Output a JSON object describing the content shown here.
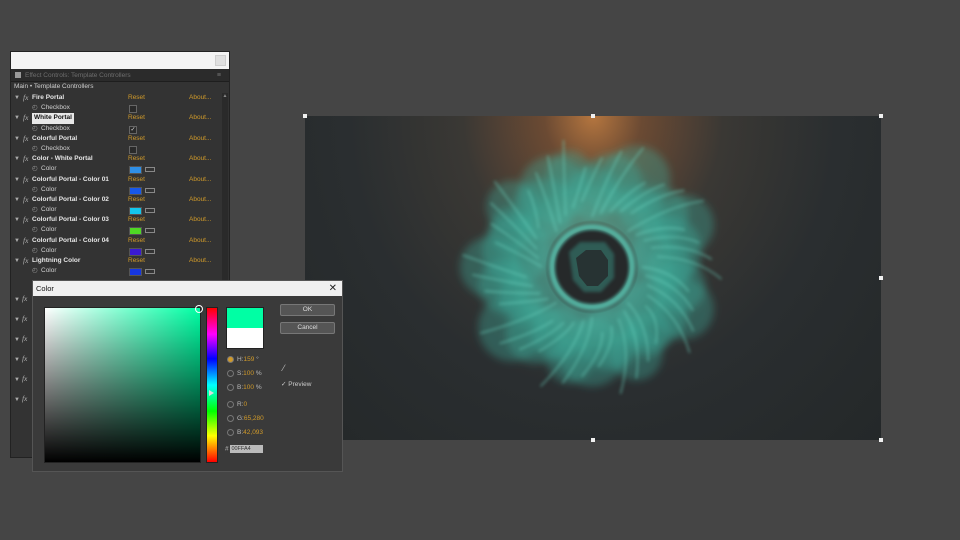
{
  "effect_controls": {
    "tab_title": "Effect Controls: Template Controllers",
    "breadcrumb": "Main • Template Controllers",
    "reset_label": "Reset",
    "about_label": "About...",
    "rows": [
      {
        "kind": "effect",
        "name": "Fire Portal",
        "selected": false
      },
      {
        "kind": "prop",
        "name": "Checkbox",
        "control": "checkbox",
        "checked": false
      },
      {
        "kind": "effect",
        "name": "White Portal",
        "selected": true
      },
      {
        "kind": "prop",
        "name": "Checkbox",
        "control": "checkbox",
        "checked": true
      },
      {
        "kind": "effect",
        "name": "Colorful Portal",
        "selected": false
      },
      {
        "kind": "prop",
        "name": "Checkbox",
        "control": "checkbox",
        "checked": false
      },
      {
        "kind": "effect",
        "name": "Color - White Portal",
        "selected": false
      },
      {
        "kind": "prop",
        "name": "Color",
        "control": "color",
        "color": "#2f8fe6"
      },
      {
        "kind": "effect",
        "name": "Colorful Portal - Color 01",
        "selected": false
      },
      {
        "kind": "prop",
        "name": "Color",
        "control": "color",
        "color": "#1858e8"
      },
      {
        "kind": "effect",
        "name": "Colorful Portal - Color 02",
        "selected": false
      },
      {
        "kind": "prop",
        "name": "Color",
        "control": "color",
        "color": "#14c6ec"
      },
      {
        "kind": "effect",
        "name": "Colorful Portal - Color 03",
        "selected": false
      },
      {
        "kind": "prop",
        "name": "Color",
        "control": "color",
        "color": "#4fd824"
      },
      {
        "kind": "effect",
        "name": "Colorful Portal - Color 04",
        "selected": false
      },
      {
        "kind": "prop",
        "name": "Color",
        "control": "color",
        "color": "#3a1ad0"
      },
      {
        "kind": "effect",
        "name": "Lightning Color",
        "selected": false
      },
      {
        "kind": "prop",
        "name": "Color",
        "control": "color",
        "color": "#1636e0"
      }
    ],
    "hidden_fx_rows": 6
  },
  "color_dialog": {
    "title": "Color",
    "close_glyph": "✕",
    "ok_label": "OK",
    "cancel_label": "Cancel",
    "new_color": "#00ffa4",
    "old_color": "#ffffff",
    "fields": [
      {
        "label": "H:",
        "value": "159",
        "unit": "°",
        "selected": true
      },
      {
        "label": "S:",
        "value": "100",
        "unit": "%",
        "selected": false
      },
      {
        "label": "B:",
        "value": "100",
        "unit": "%",
        "selected": false
      },
      {
        "label": "R:",
        "value": "0",
        "unit": "",
        "selected": false
      },
      {
        "label": "G:",
        "value": "65,280",
        "unit": "",
        "selected": false
      },
      {
        "label": "B:",
        "value": "42,093",
        "unit": "",
        "selected": false
      }
    ],
    "preview_label": "Preview",
    "preview_checked": true,
    "hex_prefix": "#",
    "hex_value": "00FFA4"
  },
  "composition": {
    "accent_smoke": "#3fb3a0"
  }
}
